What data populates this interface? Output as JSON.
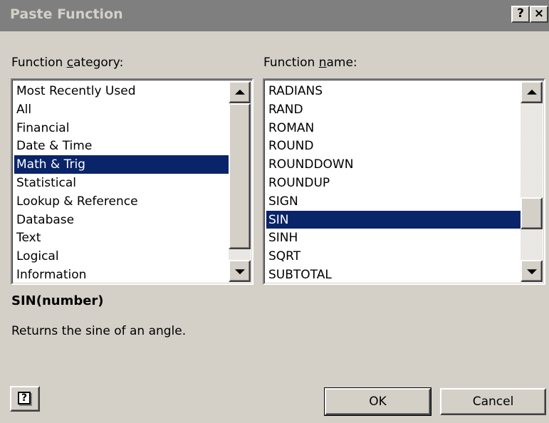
{
  "window": {
    "title": "Paste Function",
    "help_glyph": "?",
    "close_glyph": "×"
  },
  "category": {
    "label_pre": "Function ",
    "label_accel": "c",
    "label_post": "ategory:",
    "items": [
      {
        "label": "Most Recently Used"
      },
      {
        "label": "All"
      },
      {
        "label": "Financial"
      },
      {
        "label": "Date & Time"
      },
      {
        "label": "Math & Trig"
      },
      {
        "label": "Statistical"
      },
      {
        "label": "Lookup & Reference"
      },
      {
        "label": "Database"
      },
      {
        "label": "Text"
      },
      {
        "label": "Logical"
      },
      {
        "label": "Information"
      }
    ],
    "selected": "Math & Trig"
  },
  "function": {
    "label_pre": "Function ",
    "label_accel": "n",
    "label_post": "ame:",
    "items": [
      {
        "label": "RADIANS"
      },
      {
        "label": "RAND"
      },
      {
        "label": "ROMAN"
      },
      {
        "label": "ROUND"
      },
      {
        "label": "ROUNDDOWN"
      },
      {
        "label": "ROUNDUP"
      },
      {
        "label": "SIGN"
      },
      {
        "label": "SIN"
      },
      {
        "label": "SINH"
      },
      {
        "label": "SQRT"
      },
      {
        "label": "SUBTOTAL"
      }
    ],
    "selected": "SIN"
  },
  "syntax": "SIN(number)",
  "description": "Returns the sine of an angle.",
  "buttons": {
    "help_glyph": "?",
    "ok": "OK",
    "cancel": "Cancel"
  },
  "colors": {
    "dialog_bg": "#d4d0c8",
    "titlebar_bg": "#7f7f7f",
    "selection_bg": "#0a246a"
  }
}
